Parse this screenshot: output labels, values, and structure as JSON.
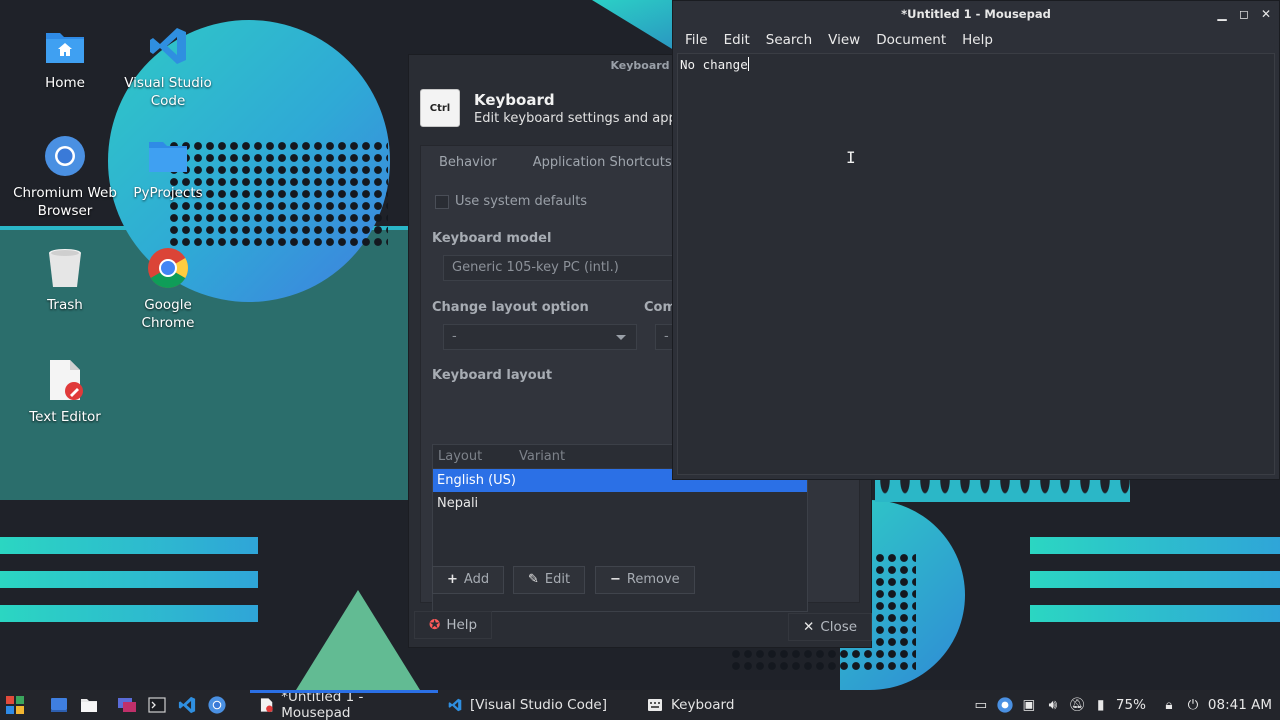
{
  "desktop": {
    "icons": [
      {
        "label": "Home",
        "icon": "home-folder-icon"
      },
      {
        "label": "Visual Studio Code",
        "icon": "vscode-icon"
      },
      {
        "label": "Chromium Web Browser",
        "icon": "chromium-icon"
      },
      {
        "label": "PyProjects",
        "icon": "folder-icon"
      },
      {
        "label": "Trash",
        "icon": "trash-icon"
      },
      {
        "label": "Google Chrome",
        "icon": "chrome-icon"
      },
      {
        "label": "Text Editor",
        "icon": "text-editor-icon"
      }
    ]
  },
  "keyboard_window": {
    "title": "Keyboard",
    "ctrl_key": "Ctrl",
    "heading": "Keyboard",
    "subheading": "Edit keyboard settings and applic",
    "tabs": [
      "Behavior",
      "Application Shortcuts"
    ],
    "use_system_defaults": "Use system defaults",
    "keyboard_model_label": "Keyboard model",
    "keyboard_model_value": "Generic 105-key PC (intl.)",
    "change_layout_label": "Change layout option",
    "change_layout_value": "-",
    "compose_label": "Com",
    "compose_value": "-",
    "keyboard_layout_label": "Keyboard layout",
    "columns": [
      "Layout",
      "Variant"
    ],
    "layouts": [
      "English (US)",
      "Nepali"
    ],
    "add_label": "Add",
    "edit_label": "Edit",
    "remove_label": "Remove",
    "help_label": "Help",
    "close_label": "Close"
  },
  "mousepad_window": {
    "title": "*Untitled 1 - Mousepad",
    "menus": [
      "File",
      "Edit",
      "Search",
      "View",
      "Document",
      "Help"
    ],
    "content": "No change"
  },
  "taskbar": {
    "tasks": [
      {
        "label": "*Untitled 1 - Mousepad",
        "icon": "mousepad-icon",
        "active": true
      },
      {
        "label": "[Visual Studio Code]",
        "icon": "vscode-icon",
        "active": false
      },
      {
        "label": "Keyboard",
        "icon": "keyboard-icon",
        "active": false
      }
    ],
    "battery": "75%",
    "clock": "08:41 AM"
  },
  "colors": {
    "accent": "#2b70e6",
    "wallpaper_teal": "#2fc9c6",
    "window_bg": "#2a2d34"
  }
}
